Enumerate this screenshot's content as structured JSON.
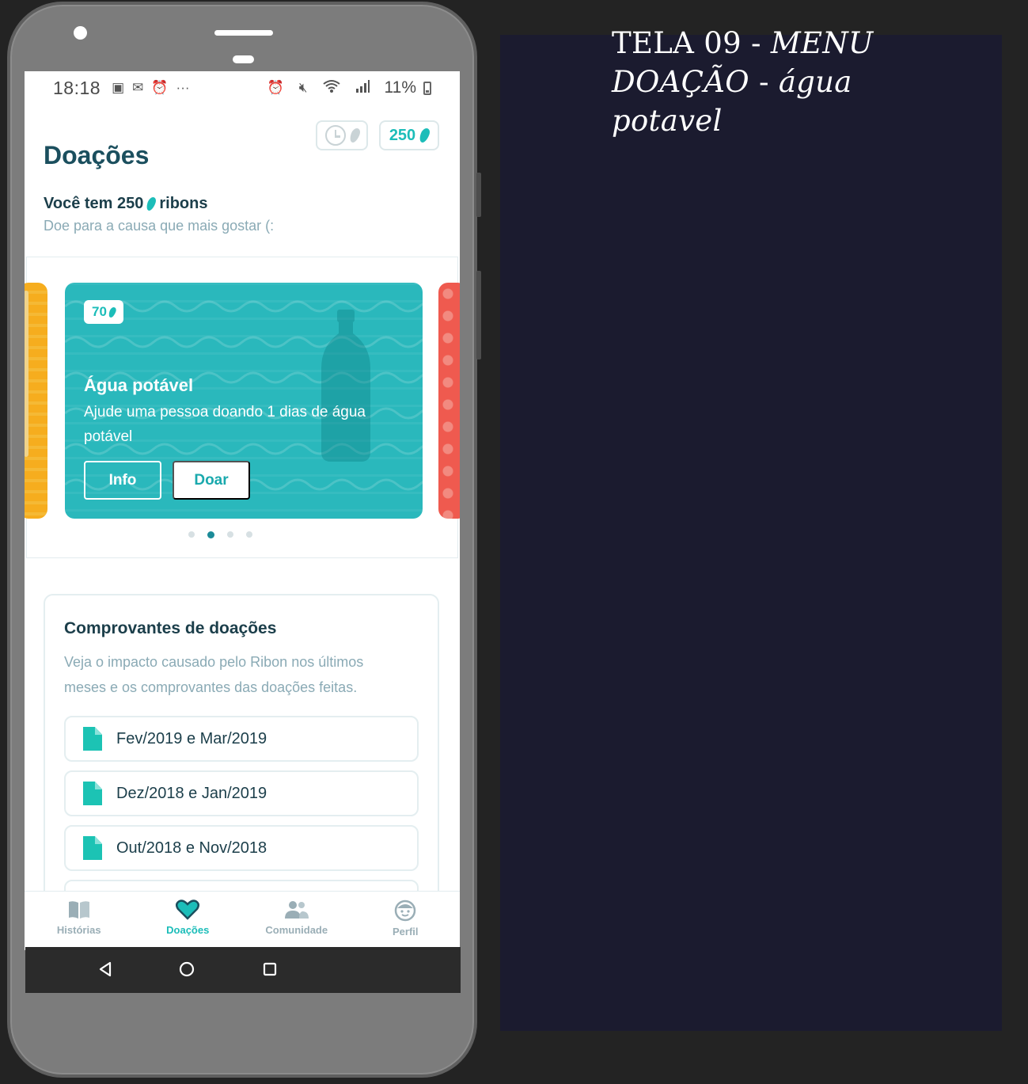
{
  "status_bar": {
    "time": "18:18",
    "battery": "11%"
  },
  "header": {
    "title": "Doações",
    "points_chip": "250",
    "balance_prefix": "Você tem 250",
    "balance_suffix": "ribons",
    "subtitle": "Doe para a causa que mais gostar (:"
  },
  "carousel": {
    "card": {
      "badge": "70",
      "title": "Água potável",
      "description": "Ajude uma pessoa doando 1 dias de água potável",
      "info_label": "Info",
      "donate_label": "Doar"
    },
    "pages": 4,
    "active_page": 2
  },
  "receipts": {
    "title": "Comprovantes de doações",
    "description": "Veja o impacto causado pelo Ribon nos últimos meses e os comprovantes das doações feitas.",
    "items": [
      "Fev/2019 e Mar/2019",
      "Dez/2018 e Jan/2019",
      "Out/2018 e Nov/2018"
    ]
  },
  "bottom_nav": {
    "items": [
      {
        "label": "Histórias",
        "icon": "book-icon"
      },
      {
        "label": "Doações",
        "icon": "heart-icon",
        "active": true
      },
      {
        "label": "Comunidade",
        "icon": "people-icon"
      },
      {
        "label": "Perfil",
        "icon": "face-icon"
      }
    ]
  },
  "caption": {
    "line1_plain": "TELA 09 - ",
    "line1_italic": "MENU",
    "line2_italic": "DOAÇÃO",
    "line2_plain": " - ",
    "line2_italic2": "água",
    "line3_italic": "potavel"
  },
  "colors": {
    "accent": "#1cbdb9",
    "card": "#2ab8bc",
    "heading": "#1b4f5e",
    "panel": "#1b1b2f"
  }
}
